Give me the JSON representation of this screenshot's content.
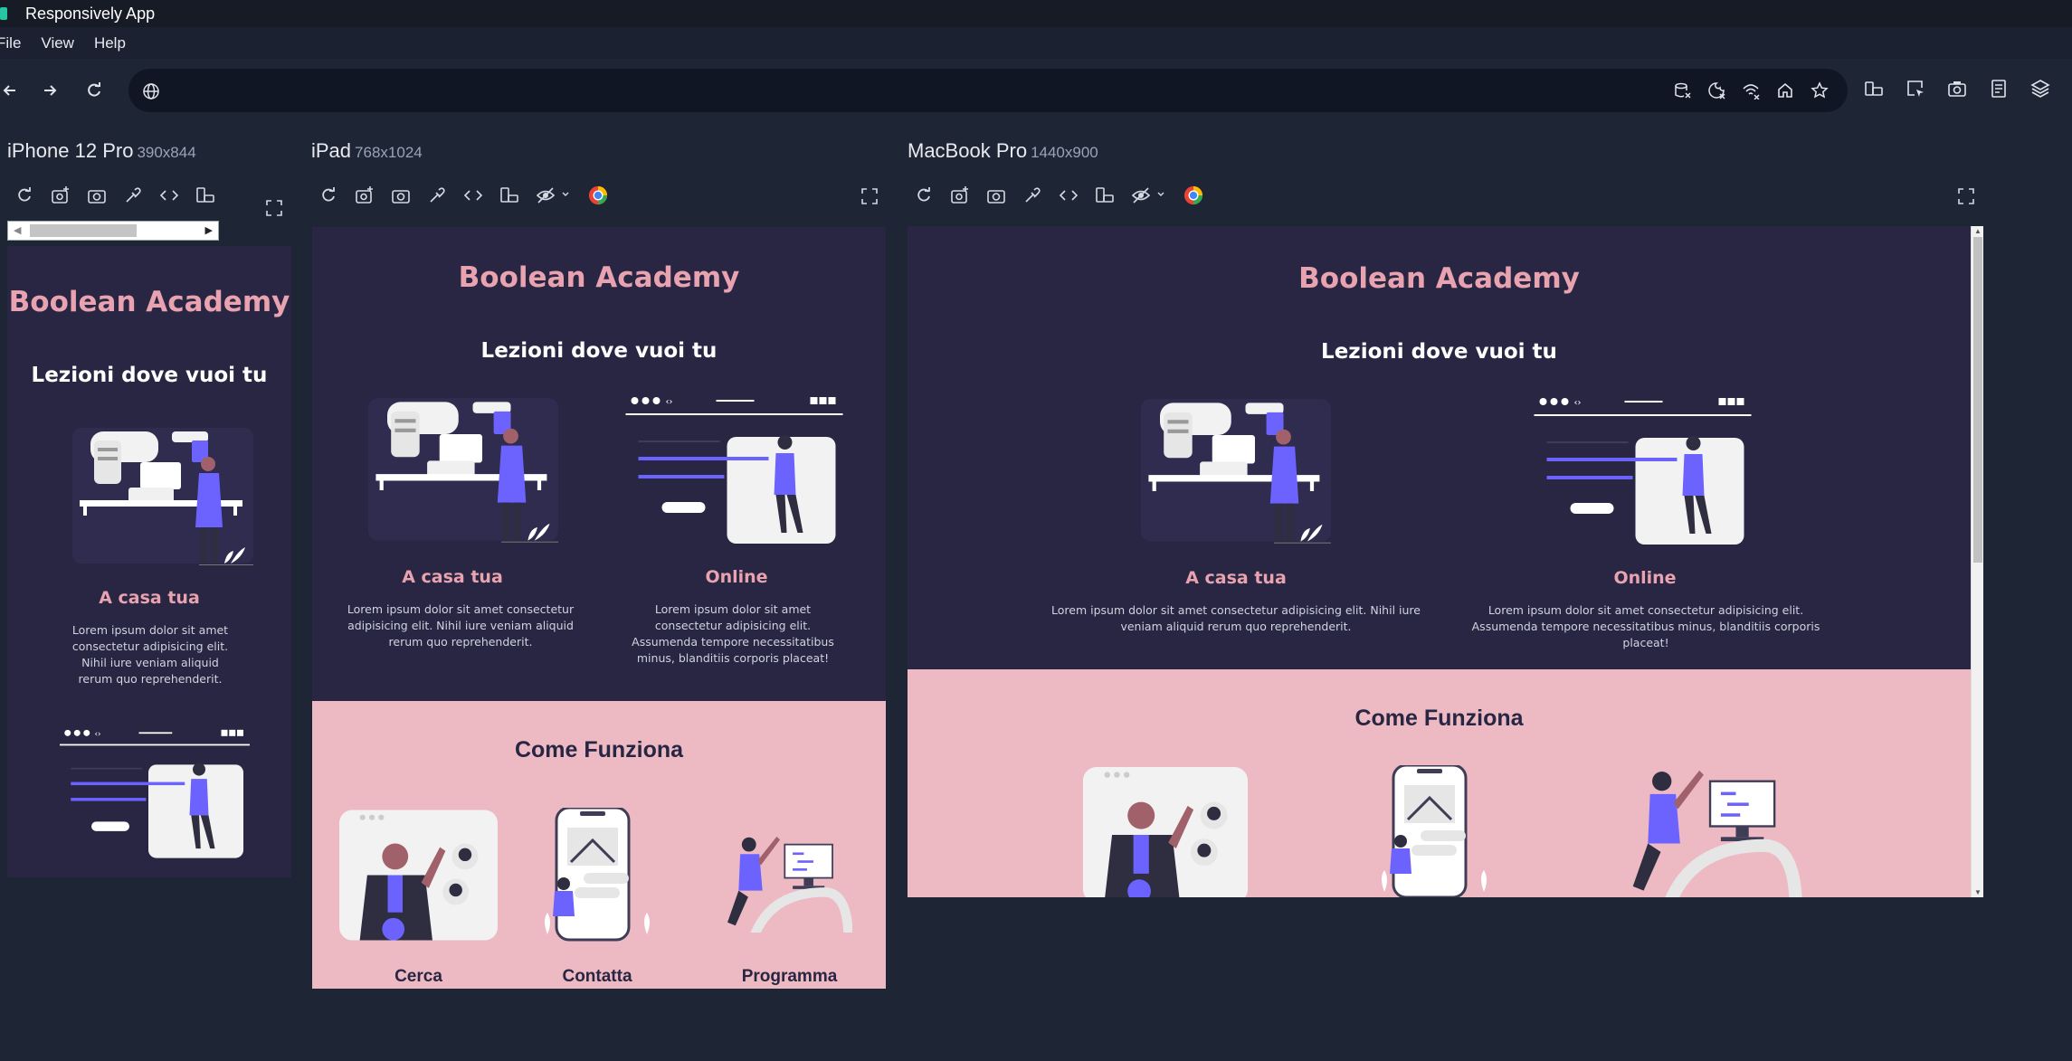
{
  "window": {
    "title": "Responsively App"
  },
  "menu": [
    "File",
    "View",
    "Help"
  ],
  "devices": [
    {
      "name": "iPhone 12 Pro",
      "size": "390x844",
      "site": {
        "brand": "Boolean Academy",
        "hero": "Lezioni dove vuoi tu",
        "card1_title": "A casa tua",
        "card1_text": "Lorem ipsum dolor sit amet consectetur adipisicing elit. Nihil iure veniam aliquid rerum quo reprehenderit."
      }
    },
    {
      "name": "iPad",
      "size": "768x1024",
      "site": {
        "brand": "Boolean Academy",
        "hero": "Lezioni dove vuoi tu",
        "card1_title": "A casa tua",
        "card1_text": "Lorem ipsum dolor sit amet consectetur adipisicing elit. Nihil iure veniam aliquid rerum quo reprehenderit.",
        "card2_title": "Online",
        "card2_text": "Lorem ipsum dolor sit amet consectetur adipisicing elit. Assumenda tempore necessitatibus minus, blanditiis corporis placeat!",
        "section2": "Come Funziona",
        "steps": [
          "Cerca",
          "Contatta",
          "Programma"
        ]
      }
    },
    {
      "name": "MacBook Pro",
      "size": "1440x900",
      "site": {
        "brand": "Boolean Academy",
        "hero": "Lezioni dove vuoi tu",
        "card1_title": "A casa tua",
        "card1_text": "Lorem ipsum dolor sit amet consectetur adipisicing elit. Nihil iure veniam aliquid rerum quo reprehenderit.",
        "card2_title": "Online",
        "card2_text": "Lorem ipsum dolor sit amet consectetur adipisicing elit. Assumenda tempore necessitatibus minus, blanditiis corporis placeat!",
        "section2": "Come Funziona"
      }
    }
  ],
  "icons": {
    "nav": [
      "back-arrow-icon",
      "forward-arrow-icon",
      "reload-icon"
    ],
    "address_bar": [
      "globe-icon",
      "clear-cache-icon",
      "clear-cookies-icon",
      "network-throttle-icon",
      "home-icon",
      "bookmark-star-icon"
    ],
    "outer": [
      "rotate-devices-icon",
      "inspect-icon",
      "screenshot-icon",
      "preview-layout-icon",
      "layers-icon"
    ]
  },
  "colors": {
    "app_bg": "#1e2535",
    "site_dark": "#282642",
    "site_pink": "#edbac4",
    "brand_pink": "#e8a2b0",
    "accent_purple": "#6c63ff"
  }
}
